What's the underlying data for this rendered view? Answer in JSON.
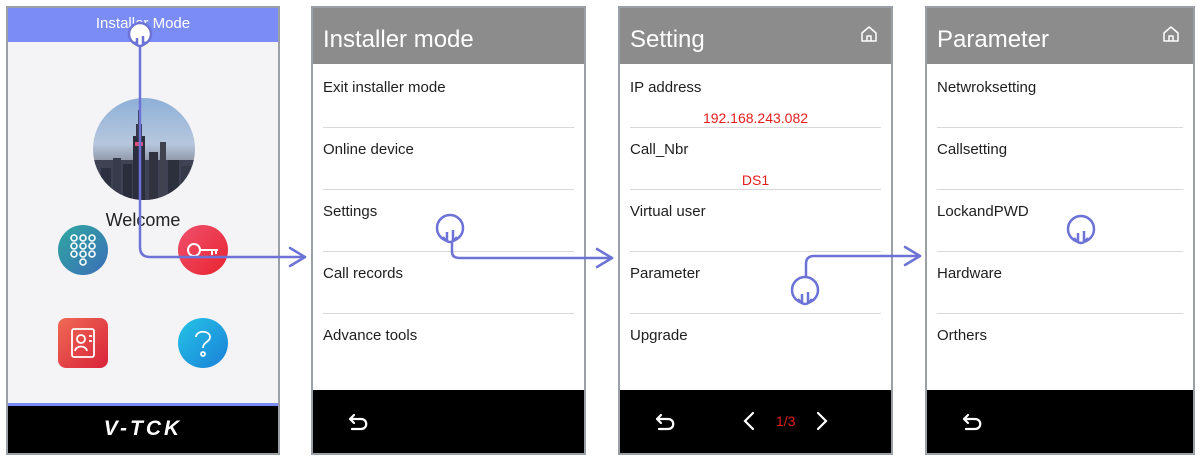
{
  "screen1": {
    "title": "Installer Mode",
    "welcome": "Welcome",
    "logo": "V-TCK",
    "icons": [
      "keypad-icon",
      "key-icon",
      "contacts-icon",
      "help-icon"
    ]
  },
  "screen2": {
    "title": "Installer mode",
    "items": [
      {
        "label": "Exit installer mode"
      },
      {
        "label": "Online device"
      },
      {
        "label": "Settings"
      },
      {
        "label": "Call records"
      },
      {
        "label": "Advance tools"
      }
    ]
  },
  "screen3": {
    "title": "Setting",
    "items": [
      {
        "label": "IP address",
        "value": "192.168.243.082"
      },
      {
        "label": "Call_Nbr",
        "value": "DS1"
      },
      {
        "label": "Virtual user"
      },
      {
        "label": "Parameter"
      },
      {
        "label": "Upgrade"
      }
    ],
    "page": "1/3"
  },
  "screen4": {
    "title": "Parameter",
    "items": [
      {
        "label": "Netwroksetting"
      },
      {
        "label": "Callsetting"
      },
      {
        "label": "LockandPWD"
      },
      {
        "label": "Hardware"
      },
      {
        "label": "Orthers"
      }
    ]
  },
  "colors": {
    "accent": "#7b8cf7",
    "header_gray": "#8c8c8c",
    "value_red": "#e51d1d",
    "flow_line": "#6c72d6"
  }
}
